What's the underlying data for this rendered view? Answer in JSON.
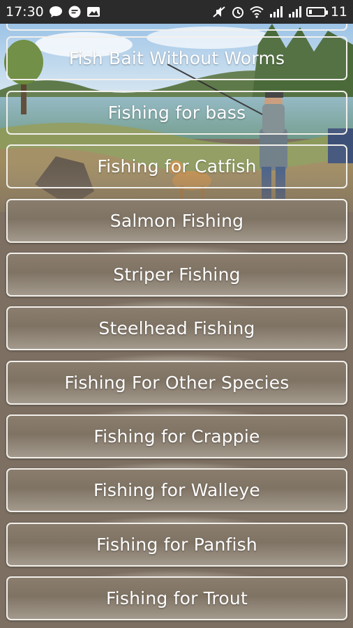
{
  "status_bar": {
    "time": "17:30",
    "battery_level": "11",
    "left_icons": [
      "chat-bubble-icon",
      "message-icon",
      "image-notification-icon"
    ],
    "right_icons": [
      "mute-icon",
      "alarm-icon",
      "wifi-icon",
      "signal-icon",
      "signal-icon",
      "battery-icon"
    ]
  },
  "menu": {
    "items": [
      {
        "label": "Fish Bait Without Worms"
      },
      {
        "label": "Fishing for  bass"
      },
      {
        "label": "Fishing for Catfish"
      },
      {
        "label": "Salmon Fishing"
      },
      {
        "label": "Striper Fishing"
      },
      {
        "label": "Steelhead Fishing"
      },
      {
        "label": "Fishing For Other Species"
      },
      {
        "label": "Fishing for Crappie"
      },
      {
        "label": "Fishing for Walleye"
      },
      {
        "label": "Fishing for Panfish"
      },
      {
        "label": "Fishing for Trout"
      }
    ]
  },
  "colors": {
    "button_fill": "#8a7d6d",
    "button_border": "#f2f0ec",
    "status_bar": "#2b2b2b"
  }
}
